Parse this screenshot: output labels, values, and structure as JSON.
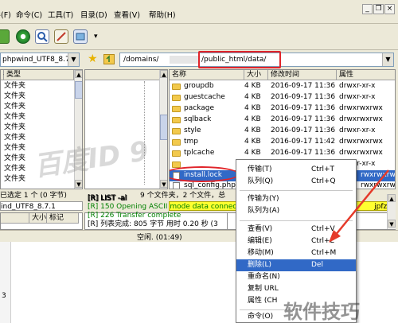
{
  "menu": {
    "items": [
      "文件(F)",
      "命令(C)",
      "工具(T)",
      "目录(D)",
      "查看(V)",
      "帮助(H)"
    ],
    "window_controls": [
      "_",
      "❐",
      "×"
    ]
  },
  "toolbar": {
    "icons": [
      "connect-icon",
      "refresh-icon",
      "search-icon",
      "edit-icon",
      "transfer-icon"
    ],
    "dropdown_arrow": "▾"
  },
  "local_path": {
    "value": "phpwind_UTF8_8.7.1"
  },
  "remote_path": {
    "value_prefix": "/domains/",
    "value_suffix": "/public_html/data/"
  },
  "local_pane": {
    "col_name": "名",
    "col_type": "类型",
    "rows": [
      "文件夹",
      "文件夹",
      "文件夹",
      "文件夹",
      "文件夹",
      "文件夹",
      "文件夹",
      "文件夹",
      "文件夹",
      "文件夹",
      "文件夹",
      "文件夹"
    ],
    "status_text": "已选定 1 个 (0 字节)",
    "pathbar_text": "ind_UTF8_8.7.1"
  },
  "tree": {
    "col_header": ""
  },
  "remote_pane": {
    "headers": {
      "name": "名称",
      "size": "大小",
      "mtime": "修改时间",
      "perm": "属性"
    },
    "rows": [
      {
        "name": "groupdb",
        "size": "4 KB",
        "mtime": "2016-09-17  11:36",
        "perm": "drwxr-xr-x"
      },
      {
        "name": "guestcache",
        "size": "4 KB",
        "mtime": "2016-09-17  11:36",
        "perm": "drwxr-xr-x"
      },
      {
        "name": "package",
        "size": "4 KB",
        "mtime": "2016-09-17  11:36",
        "perm": "drwxrwxrwx"
      },
      {
        "name": "sqlback",
        "size": "4 KB",
        "mtime": "2016-09-17  11:36",
        "perm": "drwxrwxrwx"
      },
      {
        "name": "style",
        "size": "4 KB",
        "mtime": "2016-09-17  11:36",
        "perm": "drwxr-xr-x"
      },
      {
        "name": "tmp",
        "size": "4 KB",
        "mtime": "2016-09-17  11:42",
        "perm": "drwxrwxrwx"
      },
      {
        "name": "tplcache",
        "size": "4 KB",
        "mtime": "2016-09-17  11:36",
        "perm": "drwxrwxrwx"
      },
      {
        "name": "",
        "size": "",
        "mtime": "",
        "perm": "drwxr-xr-x"
      },
      {
        "name": "install.lock",
        "size": "",
        "mtime": "",
        "perm": "rwxrwxrwx"
      },
      {
        "name": "sql_config.php",
        "size": "",
        "mtime": "",
        "perm": "rwxrwxrwx"
      }
    ],
    "status_text": "9 个文件夹，2 个文件，总",
    "pathbar_text": "jpfz1"
  },
  "queue_header": {
    "size": "大小",
    "mark": "标记"
  },
  "log": {
    "lines": [
      {
        "text": "[R] LIST -al",
        "color": "#000000"
      },
      {
        "text": "[R] 150 Opening ASCII mode data connect",
        "color": "#008000"
      },
      {
        "text": "[R] 226 Transfer complete",
        "color": "#008000"
      },
      {
        "text": "[R] 列表完成: 805 字节 用时 0.20 秒 (3",
        "color": "#000000"
      }
    ]
  },
  "bottom_status": {
    "text": "空闲. (01:49)"
  },
  "left_bottom": {
    "text": "3"
  },
  "context_menu": {
    "items": [
      {
        "label": "传输(T)",
        "shortcut": "Ctrl+T"
      },
      {
        "label": "队列(Q)",
        "shortcut": "Ctrl+Q"
      },
      {
        "label": "传输为(Y)",
        "shortcut": ""
      },
      {
        "label": "队列为(A)",
        "shortcut": ""
      },
      {
        "label": "查看(V)",
        "shortcut": "Ctrl+V"
      },
      {
        "label": "编辑(E)",
        "shortcut": "Ctrl+E"
      },
      {
        "label": "移动(M)",
        "shortcut": "Ctrl+M"
      },
      {
        "label": "删除(L)",
        "shortcut": "Del"
      },
      {
        "label": "重命名(N)",
        "shortcut": ""
      },
      {
        "label": "复制 URL",
        "shortcut": ""
      },
      {
        "label": "属性 (CH",
        "shortcut": ""
      },
      {
        "label": "命令(O)",
        "shortcut": ""
      }
    ]
  },
  "watermarks": {
    "baidu": "百度ID 9",
    "site": "软件技巧"
  },
  "colors": {
    "highlight_box": "#e0242a",
    "arrow": "#e53a2a",
    "selection": "#3169c6",
    "log_green": "#008000"
  }
}
